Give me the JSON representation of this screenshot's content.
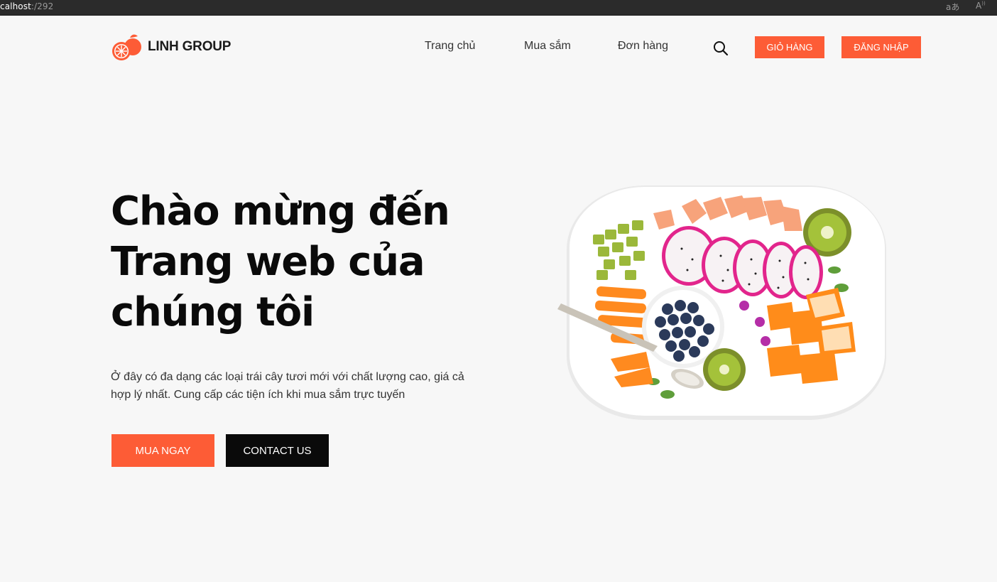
{
  "browser": {
    "url_host": "calhost",
    "url_port": ":/292",
    "icon_translate": "translate-icon",
    "icon_read": "read-aloud-icon"
  },
  "header": {
    "brand": "LINH GROUP",
    "nav": [
      {
        "label": "Trang chủ"
      },
      {
        "label": "Mua sắm"
      },
      {
        "label": "Đơn hàng"
      }
    ],
    "cart_label": "GIỎ HÀNG",
    "login_label": "ĐĂNG NHẬP"
  },
  "hero": {
    "title_lines": [
      "Chào mừng đến",
      "Trang web của",
      "chúng tôi"
    ],
    "description_lines": [
      "Ở đây có đa dạng các loại trái cây tươi mới với chất lượng cao, giá cả",
      "hợp lý nhất. Cung cấp các tiện ích khi mua sắm trực tuyến"
    ],
    "buy_label": "MUA NGAY",
    "contact_label": "CONTACT US"
  },
  "colors": {
    "accent": "#fd5c36",
    "dark": "#0a0a0a",
    "background": "#f7f7f7"
  }
}
